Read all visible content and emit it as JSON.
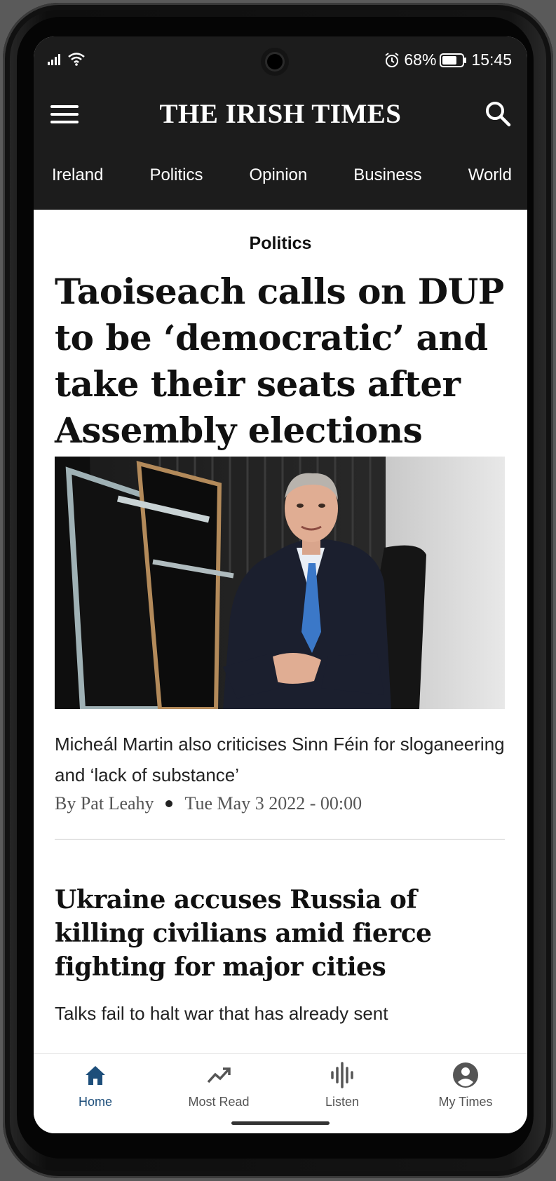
{
  "status_bar": {
    "battery": "68%",
    "time": "15:45"
  },
  "header": {
    "brand": "THE IRISH TIMES"
  },
  "nav_tabs": [
    "Ireland",
    "Politics",
    "Opinion",
    "Business",
    "World"
  ],
  "article": {
    "section": "Politics",
    "headline": "Taoiseach calls on DUP to be ‘democratic’ and take their seats after Assembly elections",
    "standfirst": "Micheál Martin also criticises Sinn Féin for sloganeering and ‘lack of substance’",
    "author": "By Pat Leahy",
    "date": "Tue May 3 2022 - 00:00"
  },
  "article2": {
    "headline": "Ukraine accuses Russia of killing civilians amid fierce fighting for major cities",
    "teaser": "Talks fail to halt war that has already sent"
  },
  "bottom_nav": [
    {
      "label": "Home",
      "icon": "home-icon",
      "active": true
    },
    {
      "label": "Most Read",
      "icon": "trending-icon",
      "active": false
    },
    {
      "label": "Listen",
      "icon": "audio-wave-icon",
      "active": false
    },
    {
      "label": "My Times",
      "icon": "account-icon",
      "active": false
    }
  ],
  "colors": {
    "header_bg": "#1c1c1c",
    "active_nav": "#1d4e7a"
  }
}
